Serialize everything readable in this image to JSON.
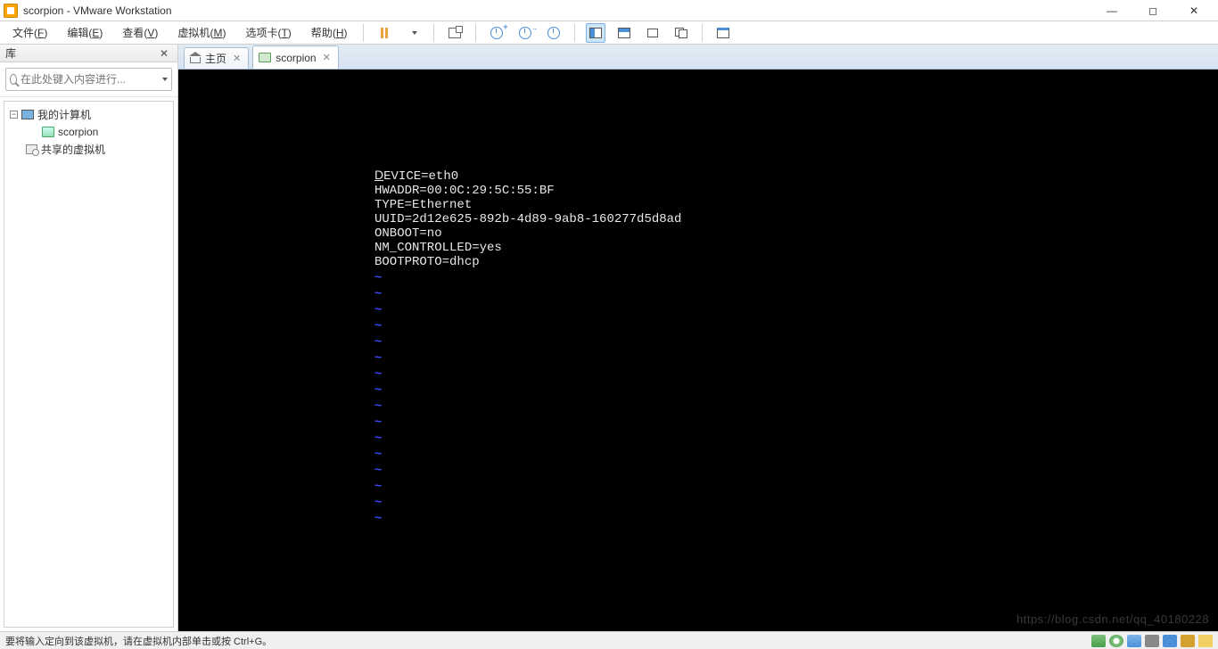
{
  "titlebar": {
    "title": "scorpion - VMware Workstation"
  },
  "menu": {
    "file": {
      "label": "文件",
      "key": "F"
    },
    "edit": {
      "label": "编辑",
      "key": "E"
    },
    "view": {
      "label": "查看",
      "key": "V"
    },
    "vm": {
      "label": "虚拟机",
      "key": "M"
    },
    "tabs": {
      "label": "选项卡",
      "key": "T"
    },
    "help": {
      "label": "帮助",
      "key": "H"
    }
  },
  "sidebar": {
    "title": "库",
    "search_placeholder": "在此处键入内容进行...",
    "tree": {
      "root": "我的计算机",
      "vm": "scorpion",
      "shared": "共享的虚拟机"
    }
  },
  "tabs": {
    "home": "主页",
    "vm": "scorpion"
  },
  "console": {
    "lines": [
      "DEVICE=eth0",
      "HWADDR=00:0C:29:5C:55:BF",
      "TYPE=Ethernet",
      "UUID=2d12e625-892b-4d89-9ab8-160277d5d8ad",
      "ONBOOT=no",
      "NM_CONTROLLED=yes",
      "BOOTPROTO=dhcp"
    ],
    "tilde_count": 16,
    "underline_first_char": "D"
  },
  "watermark": "https://blog.csdn.net/qq_40180228",
  "statusbar": {
    "text": "要将输入定向到该虚拟机，请在虚拟机内部单击或按 Ctrl+G。"
  }
}
